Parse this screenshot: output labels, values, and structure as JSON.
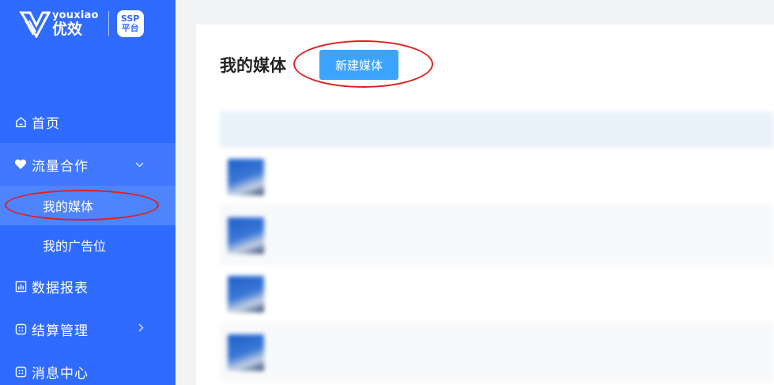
{
  "brand": {
    "en": "youxiao",
    "cn": "优效",
    "badge_top": "SSP",
    "badge_bottom": "平台"
  },
  "nav": {
    "home": "首页",
    "traffic": "流量合作",
    "my_media": "我的媒体",
    "my_ad_slots": "我的广告位",
    "reports": "数据报表",
    "settlement": "结算管理",
    "messages": "消息中心"
  },
  "page": {
    "title": "我的媒体",
    "new_button": "新建媒体"
  },
  "colors": {
    "sidebar": "#2f6bff",
    "button": "#3aa4ff",
    "annotation": "#e02020"
  },
  "table": {
    "headers": [
      "",
      "",
      ""
    ],
    "rows": [
      {
        "name": "",
        "sub": "",
        "col2": "",
        "col3": ""
      },
      {
        "name": "",
        "sub": "",
        "col2": "",
        "col3": ""
      },
      {
        "name": "",
        "sub": "",
        "col2": "",
        "col3": ""
      },
      {
        "name": "",
        "sub": "",
        "col2": "",
        "col3": ""
      }
    ]
  }
}
